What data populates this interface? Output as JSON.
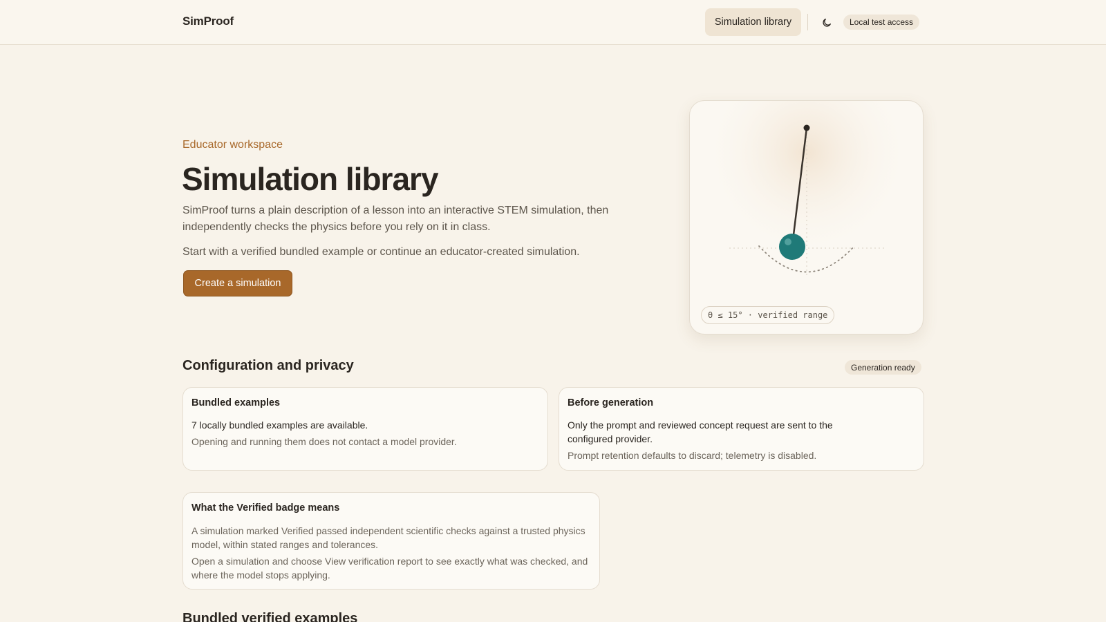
{
  "header": {
    "brand": "SimProof",
    "nav_library": "Simulation library",
    "access": "Local test access"
  },
  "hero": {
    "eyebrow": "Educator workspace",
    "title": "Simulation library",
    "lead": "SimProof turns a plain description of a lesson into an interactive STEM simulation, then independently checks the physics before you rely on it in class.",
    "lead2": "Start with a verified bundled example or continue an educator-created simulation.",
    "cta": "Create a simulation"
  },
  "pendulum": {
    "range_label": "θ ≤ 15° · verified range",
    "bob_color": "#1f7a78",
    "rod_color": "#3a332c"
  },
  "config": {
    "title": "Configuration and privacy",
    "status": "Generation ready",
    "cards": [
      {
        "title": "Bundled examples",
        "strong": "7 locally bundled examples are available.",
        "muted": "Opening and running them does not contact a model provider."
      },
      {
        "title": "Before generation",
        "strong": "Only the prompt and reviewed concept request are sent to the configured provider.",
        "muted": "Prompt retention defaults to discard; telemetry is disabled."
      },
      {
        "title": "What the Verified badge means",
        "muted": "A simulation marked Verified passed independent scientific checks against a trusted physics model, within stated ranges and tolerances.",
        "muted2": "Open a simulation and choose View verification report to see exactly what was checked, and where the model stops applying."
      }
    ]
  },
  "next_section": {
    "title": "Bundled verified examples"
  },
  "colors": {
    "accent": "#a8682a",
    "background": "#f8f3ea"
  }
}
